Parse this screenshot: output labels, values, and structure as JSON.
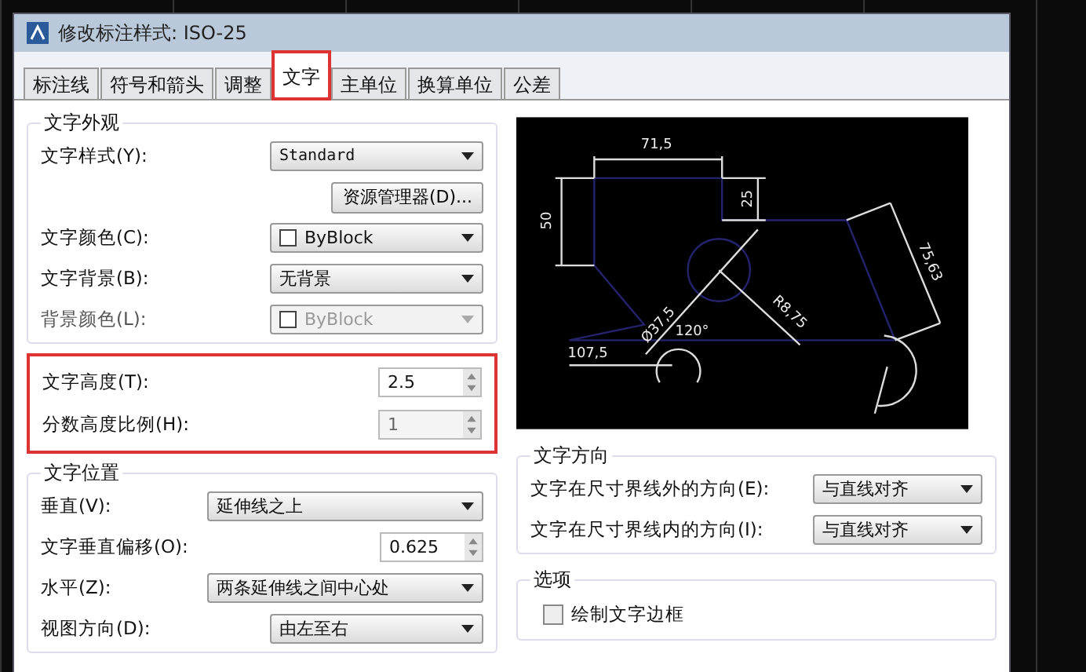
{
  "window": {
    "title": "修改标注样式: ISO-25"
  },
  "tabs": [
    {
      "label": "标注线",
      "selected": false,
      "highlighted": false
    },
    {
      "label": "符号和箭头",
      "selected": false,
      "highlighted": false
    },
    {
      "label": "调整",
      "selected": false,
      "highlighted": false
    },
    {
      "label": "文字",
      "selected": true,
      "highlighted": true
    },
    {
      "label": "主单位",
      "selected": false,
      "highlighted": false
    },
    {
      "label": "换算单位",
      "selected": false,
      "highlighted": false
    },
    {
      "label": "公差",
      "selected": false,
      "highlighted": false
    }
  ],
  "appearance": {
    "title": "文字外观",
    "rows": [
      {
        "kind": "dropdown",
        "label": "文字样式(Y):",
        "value": "Standard",
        "disabled": false
      },
      {
        "kind": "button",
        "label": "资源管理器(D)..."
      },
      {
        "kind": "color",
        "label": "文字颜色(C):",
        "value": "ByBlock",
        "disabled": false
      },
      {
        "kind": "dropdown",
        "label": "文字背景(B):",
        "value": "无背景",
        "disabled": false
      },
      {
        "kind": "color",
        "label": "背景颜色(L):",
        "value": "ByBlock",
        "disabled": true
      }
    ]
  },
  "height": {
    "highlighted": true,
    "rows": [
      {
        "label": "文字高度(T):",
        "value": "2.5",
        "disabled": false
      },
      {
        "label": "分数高度比例(H):",
        "value": "1",
        "disabled": true
      }
    ]
  },
  "placement": {
    "title": "文字位置",
    "rows": [
      {
        "kind": "dropdown",
        "label": "垂直(V):",
        "value": "延伸线之上",
        "wide": true
      },
      {
        "kind": "spinner",
        "label": "文字垂直偏移(O):",
        "value": "0.625"
      },
      {
        "kind": "dropdown",
        "label": "水平(Z):",
        "value": "两条延伸线之间中心处",
        "wide": true
      },
      {
        "kind": "dropdown",
        "label": "视图方向(D):",
        "value": "由左至右",
        "wide": false
      }
    ]
  },
  "preview": {
    "labels": [
      "71,5",
      "50",
      "25",
      "75,63",
      "Ø37,5",
      "R8,75",
      "107,5",
      "120°"
    ]
  },
  "direction": {
    "title": "文字方向",
    "rows": [
      {
        "label": "文字在尺寸界线外的方向(E):",
        "value": "与直线对齐"
      },
      {
        "label": "文字在尺寸界线内的方向(I):",
        "value": "与直线对齐"
      }
    ]
  },
  "options": {
    "title": "选项",
    "checkbox": {
      "label": "绘制文字边框",
      "checked": false
    }
  }
}
